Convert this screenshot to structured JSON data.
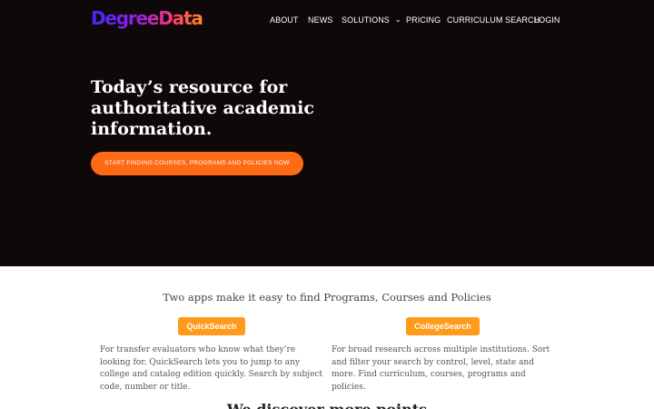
{
  "brand": {
    "logo_text": "DegreeData"
  },
  "nav": {
    "items": [
      "ABOUT",
      "NEWS",
      "SOLUTIONS",
      "PRICING",
      "CURRICULUM SEARCH",
      "LOGIN"
    ],
    "solutions_chevron_icon": "chevron-down-icon"
  },
  "hero": {
    "headline_lines": [
      "Today’s resource for",
      "authoritative academic",
      "information."
    ],
    "cta_label": "START FINDING COURSES, PROGRAMS AND POLICIES NOW"
  },
  "apps": {
    "title": "Two apps make it easy to find Programs, Courses and Policies",
    "quicksearch": {
      "label": "QuickSearch",
      "description": "For transfer evaluators who know what they’re looking for. QuickSearch lets you to jump to any college and catalog edition quickly. Search by subject code, number or title."
    },
    "collegesearch": {
      "label": "CollegeSearch",
      "description": "For broad research across multiple institutions. Sort and filter your search by control, level, state and more. Find curriculum, courses, programs and policies."
    }
  },
  "bottom_heading": "We discover more points",
  "colors": {
    "hero_bg": "#0f0808",
    "cta": "#ff6a14",
    "app_button": "#ff9a1a",
    "logo_gradient": [
      "#3a2cff",
      "#a11ee0",
      "#ff3a6e",
      "#ff8a2a"
    ]
  }
}
